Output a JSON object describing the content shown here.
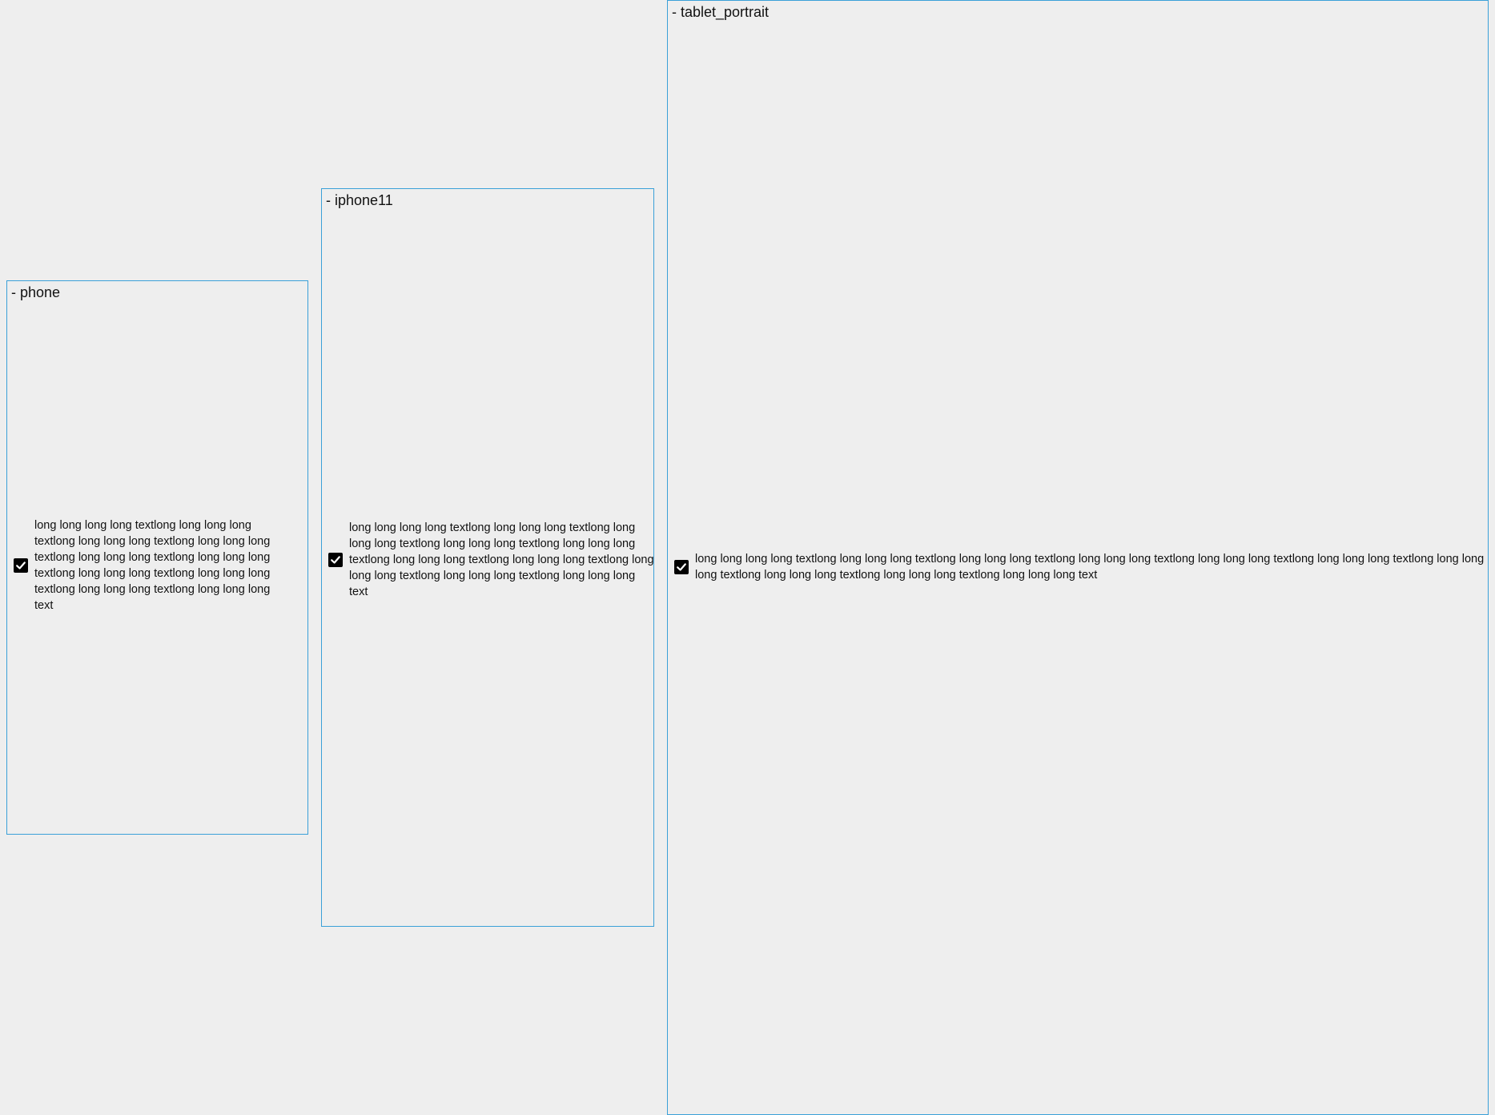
{
  "frames": {
    "phone": {
      "label": "- phone",
      "checkbox_checked": true,
      "text": "long long long long textlong long long long textlong long long long textlong long long long textlong long long long textlong long long long textlong long long long textlong long long long textlong long long long textlong long long long text"
    },
    "iphone11": {
      "label": "- iphone11",
      "checkbox_checked": true,
      "text": "long long long long textlong long long long textlong long long long textlong long long long textlong long long long textlong long long long textlong long long long textlong long long long textlong long long long textlong long long long text"
    },
    "tablet": {
      "label": "- tablet_portrait",
      "checkbox_checked": true,
      "text": "long long long long textlong long long long textlong long long long textlong long long long textlong long long long textlong long long long textlong long long long textlong long long long textlong long long long textlong long long long text"
    }
  },
  "colors": {
    "background": "#eeeeee",
    "frame_border": "#3aa0d8",
    "checkbox_fill": "#000000"
  },
  "icons": {
    "checkbox": "checkmark-icon"
  }
}
